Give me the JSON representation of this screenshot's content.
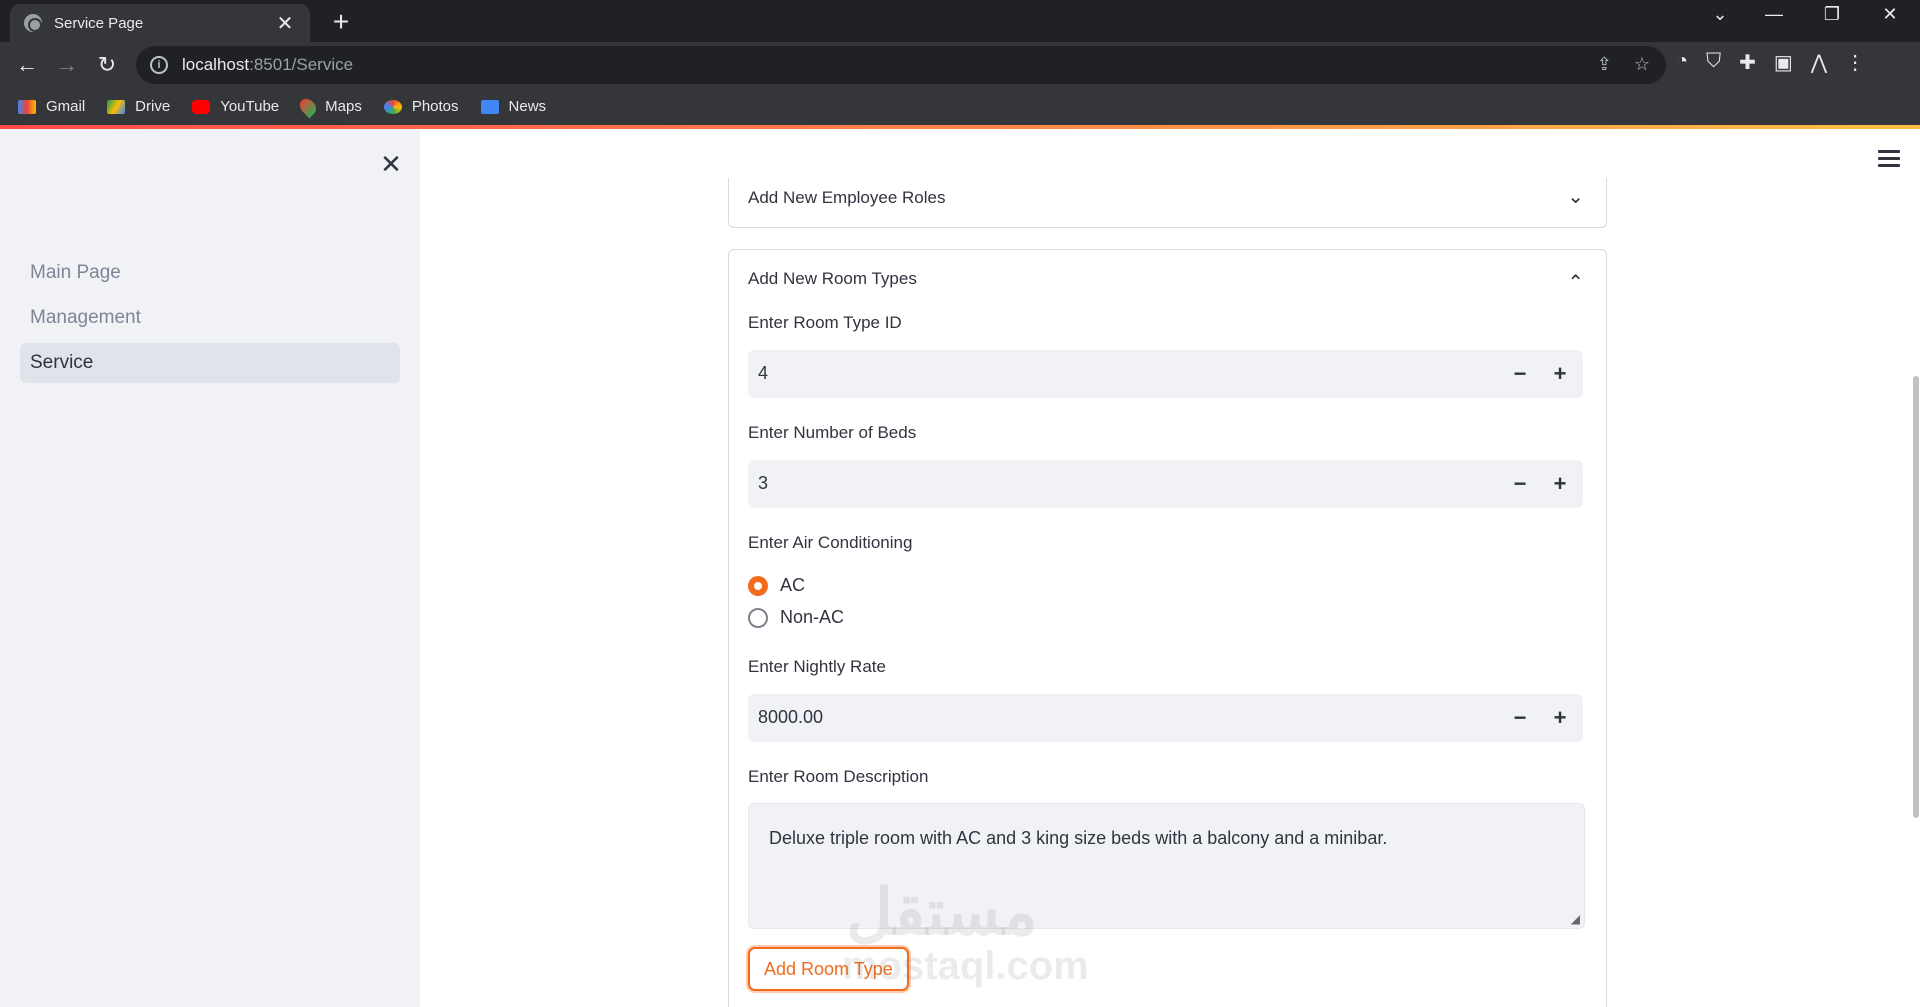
{
  "browser": {
    "tab_title": "Service Page",
    "tab_close": "✕",
    "new_tab": "+",
    "url_host": "localhost",
    "url_rest": ":8501/Service",
    "bookmarks": [
      "Gmail",
      "Drive",
      "YouTube",
      "Maps",
      "Photos",
      "News"
    ]
  },
  "sidebar": {
    "close": "✕",
    "items": [
      {
        "label": "Main Page"
      },
      {
        "label": "Management"
      },
      {
        "label": "Service"
      }
    ],
    "active_index": 2
  },
  "main": {
    "expander_roles": {
      "title": "Add New Employee Roles",
      "chevron": "⌄"
    },
    "expander_rooms": {
      "title": "Add New Room Types",
      "chevron": "⌃",
      "room_type_id": {
        "label": "Enter Room Type ID",
        "value": "4"
      },
      "beds": {
        "label": "Enter Number of Beds",
        "value": "3"
      },
      "ac": {
        "label": "Enter Air Conditioning",
        "options": [
          "AC",
          "Non-AC"
        ],
        "selected": "AC"
      },
      "rate": {
        "label": "Enter Nightly Rate",
        "value": "8000.00"
      },
      "description": {
        "label": "Enter Room Description",
        "value": "Deluxe triple room with AC and 3 king size beds with a balcony and a minibar."
      },
      "submit_label": "Add Room Type"
    },
    "stepper": {
      "minus": "−",
      "plus": "+"
    }
  },
  "watermark": {
    "arabic": "مستقل",
    "latin": "mostaql.com"
  },
  "colors": {
    "accent": "#f26b1d",
    "sidebar_bg": "#f0f2f6",
    "input_bg": "#f0f2f6"
  }
}
